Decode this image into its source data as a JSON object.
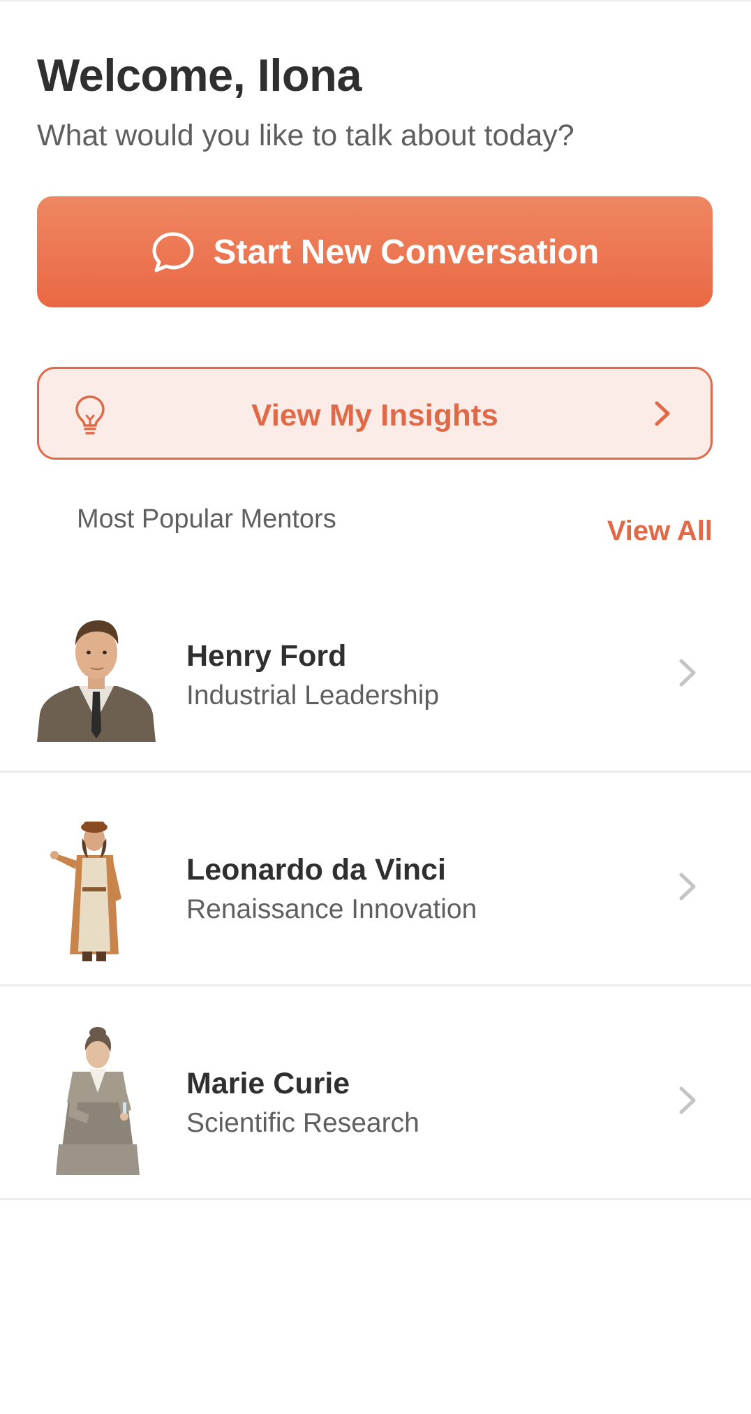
{
  "header": {
    "welcome": "Welcome, Ilona",
    "subtitle": "What would you like to talk about today?"
  },
  "actions": {
    "start_label": "Start New Conversation",
    "start_icon": "chat-bubble-icon",
    "insights_label": "View My Insights",
    "insights_icon": "lightbulb-icon"
  },
  "mentors_section": {
    "title": "Most Popular Mentors",
    "view_all": "View All",
    "items": [
      {
        "name": "Henry Ford",
        "field": "Industrial Leadership"
      },
      {
        "name": "Leonardo da Vinci",
        "field": "Renaissance Innovation"
      },
      {
        "name": "Marie Curie",
        "field": "Scientific Research"
      }
    ]
  },
  "colors": {
    "accent": "#e96a44",
    "accent_light": "#fbece8",
    "text_dark": "#2f2f2f",
    "text_muted": "#5f5f5f",
    "divider": "#ececec"
  }
}
